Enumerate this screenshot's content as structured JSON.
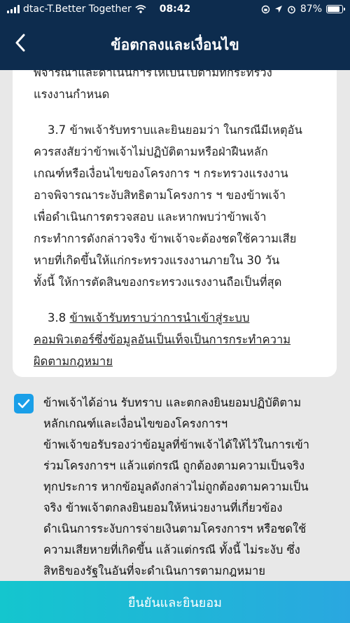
{
  "status_bar": {
    "carrier": "dtac-T.Better Together",
    "time": "08:42",
    "battery": "87%",
    "battery_level": 0.87
  },
  "header": {
    "title": "ข้อตกลงและเงื่อนไข",
    "back_icon": "chevron-left-icon"
  },
  "terms": {
    "clipped_line": "พิจารณาและดำเนินการให้เป็นไปตามที่กระทรวง",
    "partial_line": "แรงงานกำหนด",
    "clause_3_7": [
      "3.7 ข้าพเจ้ารับทราบและยินยอมว่า ในกรณีมีเหตุอัน",
      "ควรสงสัยว่าข้าพเจ้าไม่ปฏิบัติตามหรือฝ่าฝืนหลัก",
      "เกณฑ์หรือเงื่อนไขของโครงการ ฯ กระทรวงแรงงาน",
      "อาจพิจารณาระงับสิทธิตามโครงการ ฯ ของข้าพเจ้า",
      "เพื่อดำเนินการตรวจสอบ และหากพบว่าข้าพเจ้า",
      "กระทำการดังกล่าวจริง ข้าพเจ้าจะต้องชดใช้ความเสีย",
      "หายที่เกิดขึ้นให้แก่กระทรวงแรงงานภายใน 30 วัน",
      "ทั้งนี้ ให้การตัดสินของกระทรวงแรงงานถือเป็นที่สุด"
    ],
    "clause_3_8": [
      "3.8 ข้าพเจ้ารับทราบว่าการนำเข้าสู่ระบบ",
      "คอมพิวเตอร์ซึ่งข้อมูลอันเป็นเท็จเป็นการกระทำความ",
      "ผิดตามกฎหมาย"
    ]
  },
  "agreement": {
    "checked": true,
    "lines": [
      "ข้าพเจ้าได้อ่าน รับทราบ และตกลงยินยอมปฏิบัติตาม",
      "หลักเกณฑ์และเงื่อนไขของโครงการฯ",
      "ข้าพเจ้าขอรับรองว่าข้อมูลที่ข้าพเจ้าได้ให้ไว้ในการเข้า",
      "ร่วมโครงการฯ แล้วแต่กรณี ถูกต้องตามความเป็นจริง",
      "ทุกประการ หากข้อมูลดังกล่าวไม่ถูกต้องตามความเป็น",
      "จริง ข้าพเจ้าตกลงยินยอมให้หน่วยงานที่เกี่ยวข้อง",
      "ดำเนินการระงับการจ่ายเงินตามโครงการฯ หรือชดใช้",
      "ความเสียหายที่เกิดขึ้น แล้วแต่กรณี ทั้งนี้ ไม่ระงับ ซึ่ง",
      "สิทธิของรัฐในอันที่จะดำเนินการตามกฎหมาย"
    ]
  },
  "confirm_button": {
    "label": "ยืนยันและยินยอม"
  },
  "colors": {
    "header_bg": "#0d2c4e",
    "checkbox": "#1a9fe8",
    "button_start": "#14c6ce",
    "button_end": "#2aa7e0"
  }
}
